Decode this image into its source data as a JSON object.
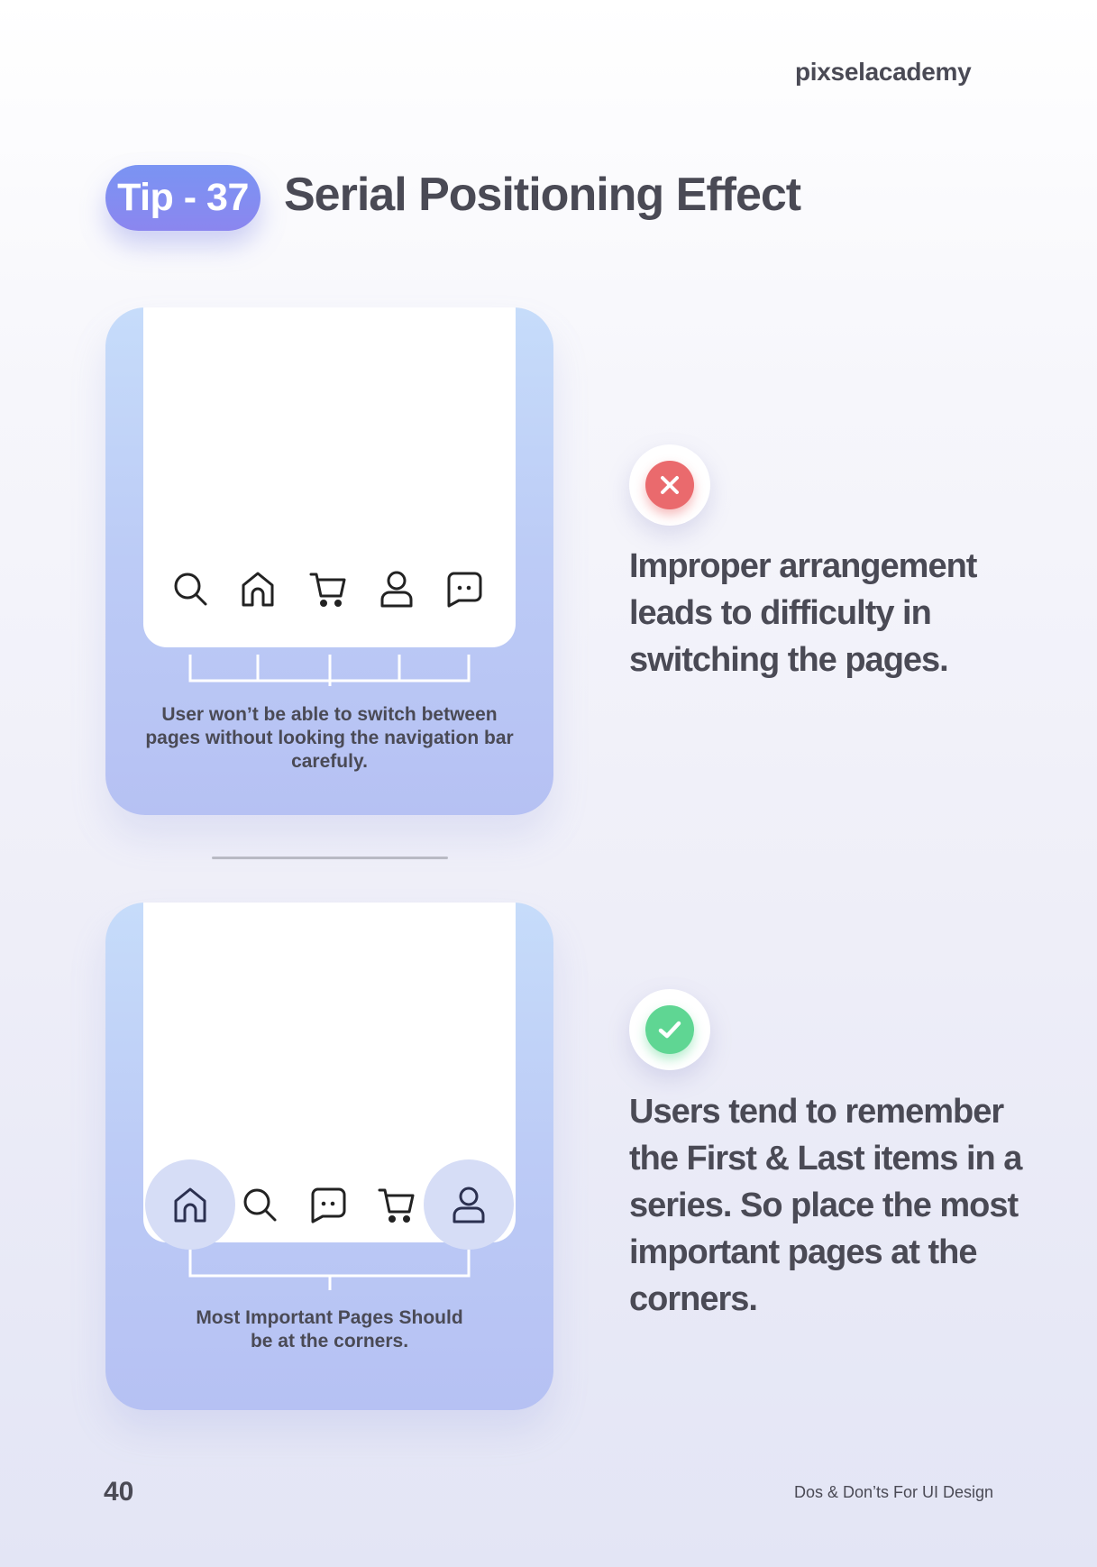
{
  "header": {
    "brand": "pixselacademy",
    "tip_badge": "Tip - 37",
    "title": "Serial Positioning Effect"
  },
  "bad_example": {
    "nav_icons": [
      "search-icon",
      "home-icon",
      "cart-icon",
      "user-icon",
      "chat-icon"
    ],
    "caption": "User won’t be able to switch between pages without looking the navigation bar carefuly.",
    "statement": "Improper arrangement leads to difficulty in switching the pages."
  },
  "good_example": {
    "nav_icons": [
      "home-icon",
      "search-icon",
      "chat-icon",
      "cart-icon",
      "user-icon"
    ],
    "caption": "Most Important Pages Should be at the corners.",
    "statement": "Users  tend to remember the First & Last items in a series. So place the most important pages at the corners."
  },
  "colors": {
    "accent": "#7a94f3",
    "bad": "#ea6a6d",
    "good": "#5fd693",
    "text": "#4a4a55"
  },
  "footer": {
    "page_number": "40",
    "document_title": "Dos & Don’ts For UI Design"
  }
}
